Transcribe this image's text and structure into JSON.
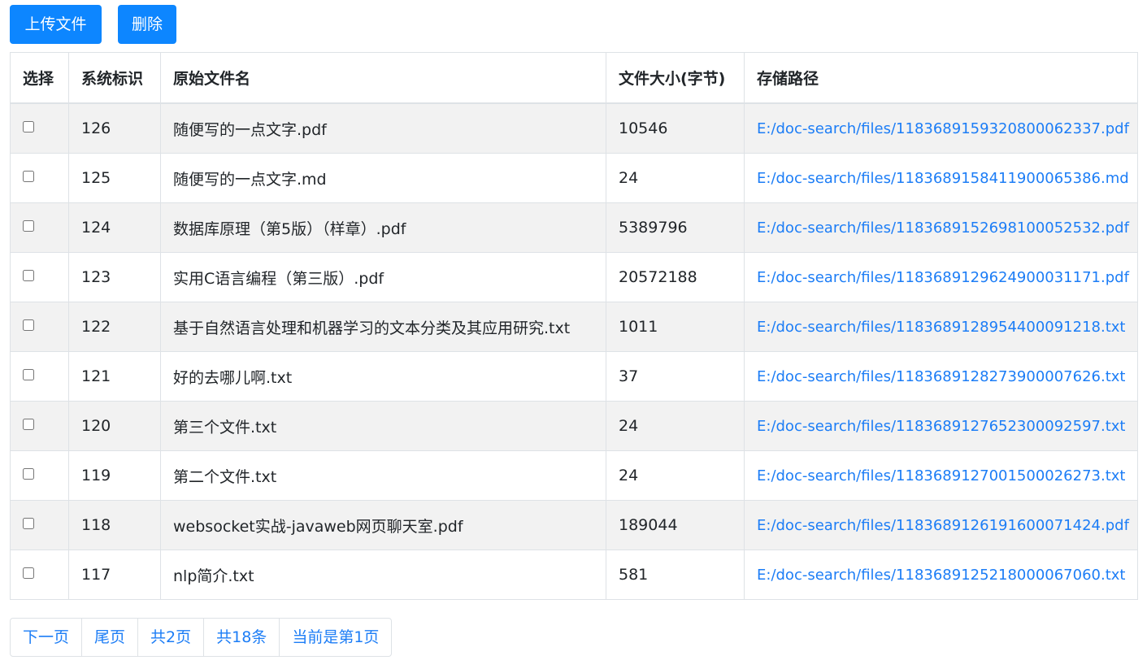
{
  "toolbar": {
    "upload_label": "上传文件",
    "delete_label": "删除"
  },
  "table": {
    "headers": {
      "select": "选择",
      "id": "系统标识",
      "name": "原始文件名",
      "size": "文件大小(字节)",
      "path": "存储路径"
    },
    "rows": [
      {
        "checked": false,
        "id": "126",
        "name": "随便写的一点文字.pdf",
        "size": "10546",
        "path": "E:/doc-search/files/1183689159320800062337.pdf"
      },
      {
        "checked": false,
        "id": "125",
        "name": "随便写的一点文字.md",
        "size": "24",
        "path": "E:/doc-search/files/1183689158411900065386.md"
      },
      {
        "checked": false,
        "id": "124",
        "name": "数据库原理（第5版）（样章）.pdf",
        "size": "5389796",
        "path": "E:/doc-search/files/1183689152698100052532.pdf"
      },
      {
        "checked": false,
        "id": "123",
        "name": "实用C语言编程（第三版）.pdf",
        "size": "20572188",
        "path": "E:/doc-search/files/1183689129624900031171.pdf"
      },
      {
        "checked": false,
        "id": "122",
        "name": "基于自然语言处理和机器学习的文本分类及其应用研究.txt",
        "size": "1011",
        "path": "E:/doc-search/files/1183689128954400091218.txt"
      },
      {
        "checked": false,
        "id": "121",
        "name": "好的去哪儿啊.txt",
        "size": "37",
        "path": "E:/doc-search/files/1183689128273900007626.txt"
      },
      {
        "checked": false,
        "id": "120",
        "name": "第三个文件.txt",
        "size": "24",
        "path": "E:/doc-search/files/1183689127652300092597.txt"
      },
      {
        "checked": false,
        "id": "119",
        "name": "第二个文件.txt",
        "size": "24",
        "path": "E:/doc-search/files/1183689127001500026273.txt"
      },
      {
        "checked": false,
        "id": "118",
        "name": "websocket实战-javaweb网页聊天室.pdf",
        "size": "189044",
        "path": "E:/doc-search/files/1183689126191600071424.pdf"
      },
      {
        "checked": false,
        "id": "117",
        "name": "nlp简介.txt",
        "size": "581",
        "path": "E:/doc-search/files/1183689125218000067060.txt"
      }
    ]
  },
  "pagination": {
    "next": "下一页",
    "last": "尾页",
    "total_pages": "共2页",
    "total_items": "共18条",
    "current": "当前是第1页"
  },
  "colors": {
    "primary": "#0d86ff",
    "link": "#1c7df6",
    "stripe": "#f2f2f2",
    "border": "#dee2e6"
  }
}
